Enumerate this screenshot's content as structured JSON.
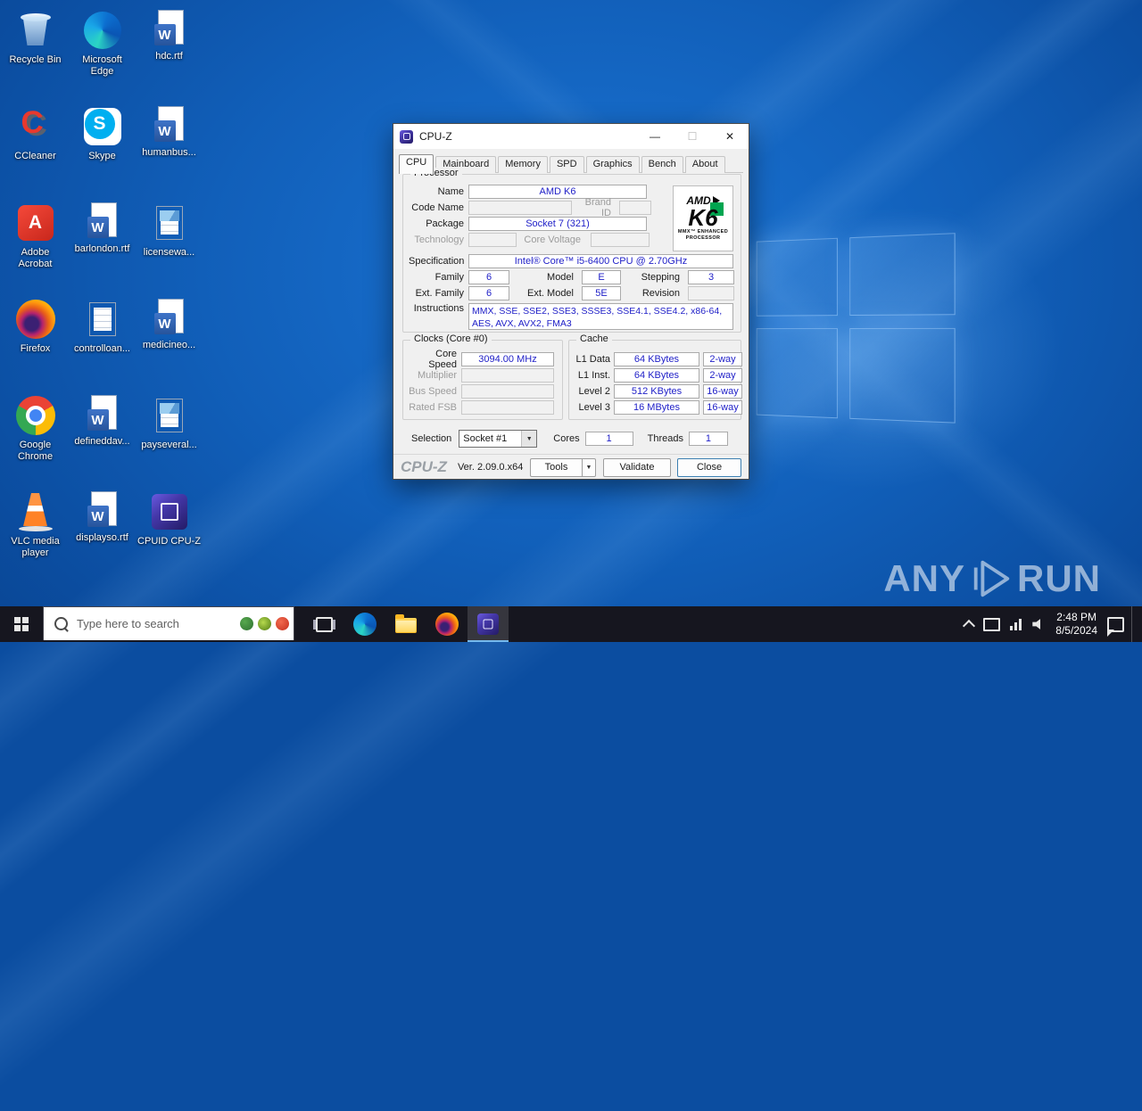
{
  "colors": {
    "accent_blue_field_text": "#2121c8",
    "taskbar_background": "#16161f",
    "desktop_blue": "#115fb9",
    "window_background": "#f0f0f0",
    "title_bar_background": "#ffffff",
    "active_app_underline": "#76b9ed",
    "amd_logo_green": "#00a550"
  },
  "desktop": {
    "icons": [
      {
        "name": "recycle-bin",
        "label": "Recycle Bin"
      },
      {
        "name": "microsoft-edge",
        "label": "Microsoft Edge"
      },
      {
        "name": "hdc-rtf",
        "label": "hdc.rtf"
      },
      {
        "name": "ccleaner",
        "label": "CCleaner"
      },
      {
        "name": "skype",
        "label": "Skype"
      },
      {
        "name": "humanbus",
        "label": "humanbus..."
      },
      {
        "name": "adobe-acrobat",
        "label": "Adobe Acrobat"
      },
      {
        "name": "barlondon-rtf",
        "label": "barlondon.rtf"
      },
      {
        "name": "licensewa",
        "label": "licensewa..."
      },
      {
        "name": "firefox",
        "label": "Firefox"
      },
      {
        "name": "controlloan",
        "label": "controlloan..."
      },
      {
        "name": "medicineo",
        "label": "medicineo..."
      },
      {
        "name": "google-chrome",
        "label": "Google Chrome"
      },
      {
        "name": "defineddav",
        "label": "defineddav..."
      },
      {
        "name": "payseveral",
        "label": "payseveral..."
      },
      {
        "name": "vlc-media-player",
        "label": "VLC media player"
      },
      {
        "name": "displayso-rtf",
        "label": "displayso.rtf"
      },
      {
        "name": "cpuid-cpuz",
        "label": "CPUID CPU-Z"
      }
    ]
  },
  "watermark": {
    "left": "ANY",
    "right": "RUN"
  },
  "window": {
    "title": "CPU-Z",
    "controls": {
      "minimize": "—",
      "maximize": "☐",
      "close": "✕"
    },
    "tabs": [
      "CPU",
      "Mainboard",
      "Memory",
      "SPD",
      "Graphics",
      "Bench",
      "About"
    ],
    "active_tab": "CPU",
    "processor": {
      "group_label": "Processor",
      "name_label": "Name",
      "name_value": "AMD K6",
      "code_name_label": "Code Name",
      "code_name_value": "",
      "brand_id_label": "Brand ID",
      "brand_id_value": "",
      "package_label": "Package",
      "package_value": "Socket 7 (321)",
      "technology_label": "Technology",
      "technology_value": "",
      "core_voltage_label": "Core Voltage",
      "core_voltage_value": "",
      "specification_label": "Specification",
      "specification_value": "Intel® Core™ i5-6400 CPU @ 2.70GHz",
      "family_label": "Family",
      "family_value": "6",
      "model_label": "Model",
      "model_value": "E",
      "stepping_label": "Stepping",
      "stepping_value": "3",
      "ext_family_label": "Ext. Family",
      "ext_family_value": "6",
      "ext_model_label": "Ext. Model",
      "ext_model_value": "5E",
      "revision_label": "Revision",
      "revision_value": "",
      "instructions_label": "Instructions",
      "instructions_value": "MMX, SSE, SSE2, SSE3, SSSE3, SSE4.1, SSE4.2, x86-64, AES, AVX, AVX2, FMA3",
      "logo": {
        "brand": "AMD",
        "model": "K6",
        "sub1": "MMX™ ENHANCED",
        "sub2": "PROCESSOR"
      }
    },
    "clocks": {
      "group_label": "Clocks (Core #0)",
      "rows": [
        {
          "label": "Core Speed",
          "value": "3094.00 MHz"
        },
        {
          "label": "Multiplier",
          "value": ""
        },
        {
          "label": "Bus Speed",
          "value": ""
        },
        {
          "label": "Rated FSB",
          "value": ""
        }
      ]
    },
    "cache": {
      "group_label": "Cache",
      "rows": [
        {
          "label": "L1 Data",
          "size": "64 KBytes",
          "ways": "2-way"
        },
        {
          "label": "L1 Inst.",
          "size": "64 KBytes",
          "ways": "2-way"
        },
        {
          "label": "Level 2",
          "size": "512 KBytes",
          "ways": "16-way"
        },
        {
          "label": "Level 3",
          "size": "16 MBytes",
          "ways": "16-way"
        }
      ]
    },
    "selection": {
      "label": "Selection",
      "socket": "Socket #1",
      "cores_label": "Cores",
      "cores_value": "1",
      "threads_label": "Threads",
      "threads_value": "1",
      "dropdown_arrow": "▼"
    },
    "footer": {
      "logo": "CPU-Z",
      "version": "Ver. 2.09.0.x64",
      "tools_label": "Tools",
      "tools_arrow": "▼",
      "validate_label": "Validate",
      "close_label": "Close"
    }
  },
  "taskbar": {
    "search_placeholder": "Type here to search",
    "clock_time": "2:48 PM",
    "clock_date": "8/5/2024"
  }
}
